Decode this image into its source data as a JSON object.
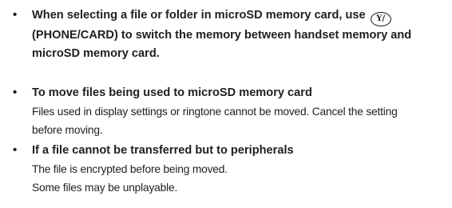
{
  "notes": [
    {
      "heading_before_icon": "When selecting a file or folder in microSD memory card, use",
      "icon_name": "y-key-icon",
      "icon_label": "Y/",
      "heading_line2": "(PHONE/CARD) to switch the memory between handset memory and",
      "heading_line3": "microSD memory card."
    },
    {
      "heading": "To move files being used to microSD memory card",
      "body": [
        "Files used in display settings or ringtone cannot be moved. Cancel the setting",
        "before moving."
      ]
    },
    {
      "heading": "If a file cannot be transferred but to peripherals",
      "body": [
        "The file is encrypted before being moved.",
        "Some files may be unplayable."
      ]
    }
  ]
}
